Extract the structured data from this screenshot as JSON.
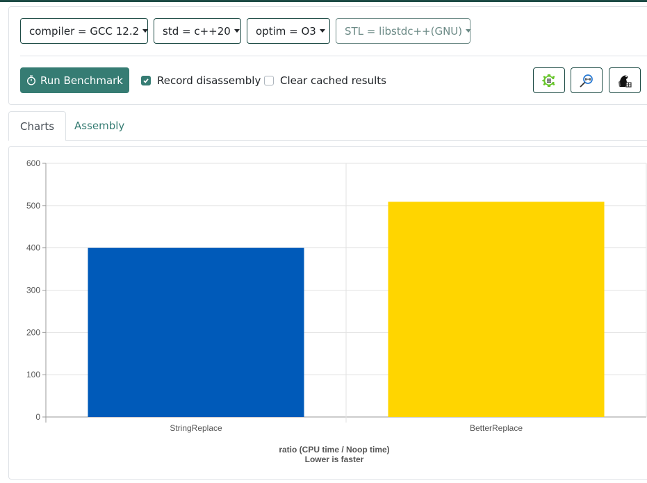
{
  "toolbar": {
    "compiler": "compiler = GCC 12.2",
    "std": "std = c++20",
    "optim": "optim = O3",
    "stl": "STL = libstdc++(GNU)",
    "run_label": "Run Benchmark",
    "record_disassembly": {
      "label": "Record disassembly",
      "checked": true
    },
    "clear_cache": {
      "label": "Clear cached results",
      "checked": false
    },
    "icon_buttons": [
      "compiler-explorer-icon",
      "quick-bench-icon",
      "build-bench-icon"
    ]
  },
  "tabs": [
    {
      "label": "Charts",
      "active": true
    },
    {
      "label": "Assembly",
      "active": false
    }
  ],
  "colors": {
    "accent": "#367c73",
    "dark": "#1d4b45",
    "bar1": "#005ab9",
    "bar2": "#ffd500"
  },
  "chart_data": {
    "type": "bar",
    "categories": [
      "StringReplace",
      "BetterReplace"
    ],
    "values": [
      400,
      509
    ],
    "colors": [
      "#005ab9",
      "#ffd500"
    ],
    "title": "",
    "xlabel": "ratio (CPU time / Noop time)",
    "xlabel2": "Lower is faster",
    "ylabel": "",
    "ylim": [
      0,
      600
    ],
    "yticks": [
      0,
      100,
      200,
      300,
      400,
      500,
      600
    ],
    "grid": true
  }
}
